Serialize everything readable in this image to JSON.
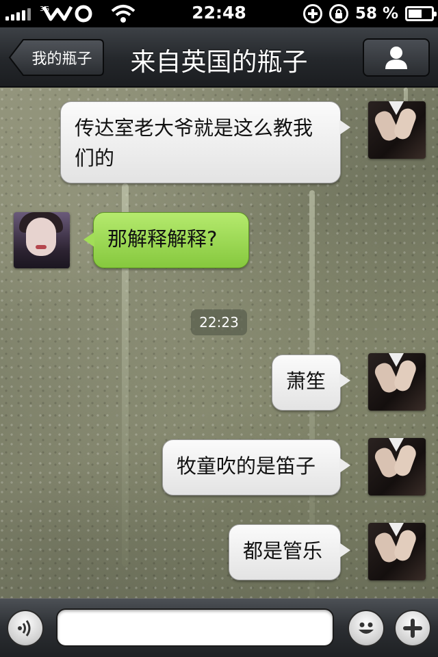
{
  "status_bar": {
    "time": "22:48",
    "battery_percent": "58 %",
    "battery_level": 0.58,
    "icons": [
      "signal-bars-icon",
      "carrier-wo-icon",
      "wifi-icon",
      "add-circle-icon",
      "rotation-lock-icon",
      "battery-icon"
    ]
  },
  "nav": {
    "back_label": "我的瓶子",
    "title": "来自英国的瓶子",
    "profile_icon": "person-icon"
  },
  "messages": [
    {
      "side": "right",
      "text": "传达室老大爷就是这么教我们的"
    },
    {
      "side": "left",
      "text": "那解释解释?"
    },
    {
      "side": "right",
      "text": "萧笙"
    },
    {
      "side": "right",
      "text": "牧童吹的是笛子"
    },
    {
      "side": "right",
      "text": "都是管乐"
    }
  ],
  "timestamp": "22:23",
  "input_bar": {
    "voice_icon": "voice-icon",
    "emoji_icon": "smiley-icon",
    "add_icon": "plus-icon",
    "placeholder": ""
  },
  "colors": {
    "sent_bubble": "#efefef",
    "received_bubble": "#a2dd58",
    "nav_bar": "#2a2d31"
  }
}
